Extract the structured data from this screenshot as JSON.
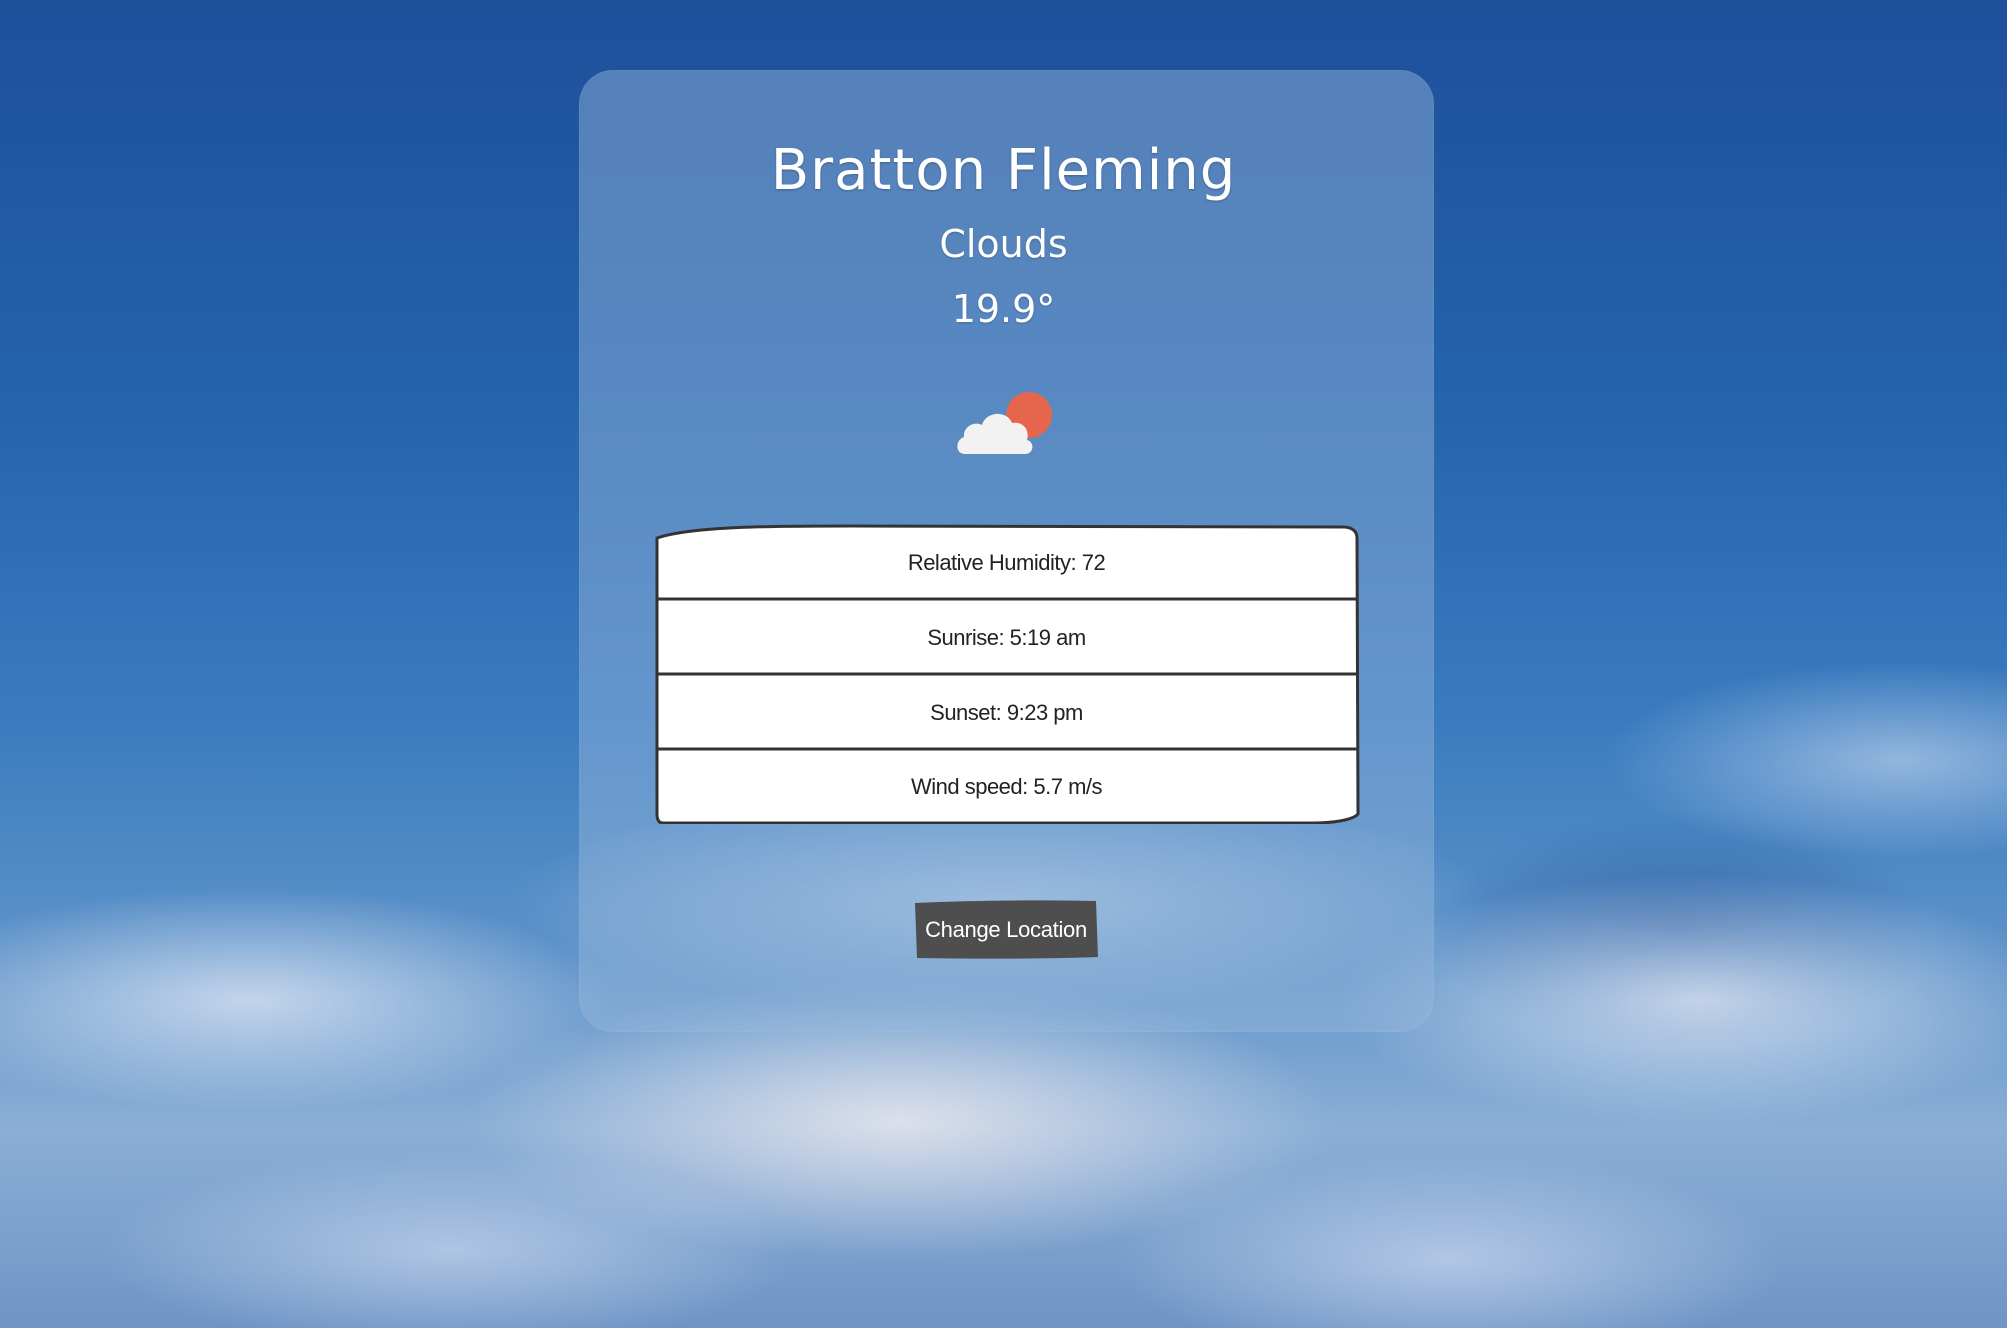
{
  "location": {
    "city": "Bratton Fleming",
    "condition": "Clouds",
    "temperature": "19.9°"
  },
  "icon": {
    "name": "cloud-sun-icon",
    "sun_color": "#e5664c",
    "cloud_color": "#f2f2f2"
  },
  "details": [
    {
      "label": "Relative Humidity: 72"
    },
    {
      "label": "Sunrise: 5:19 am"
    },
    {
      "label": "Sunset: 9:23 pm"
    },
    {
      "label": "Wind speed: 5.7 m/s"
    }
  ],
  "actions": {
    "change_location_label": "Change Location",
    "button_color": "#4e4e4e"
  }
}
